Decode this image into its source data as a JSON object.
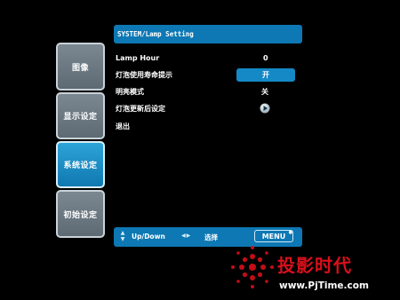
{
  "side_tabs": [
    {
      "label": "图像",
      "active": false
    },
    {
      "label": "显示设定",
      "active": false
    },
    {
      "label": "系统设定",
      "active": true
    },
    {
      "label": "初始设定",
      "active": false
    }
  ],
  "header": {
    "title": "SYSTEM/Lamp Setting"
  },
  "menu": {
    "items": [
      {
        "label": "Lamp Hour",
        "value": "0"
      },
      {
        "label": "灯泡使用寿命提示",
        "value": "开"
      },
      {
        "label": "明亮模式",
        "value": "关"
      },
      {
        "label": "灯泡更新后设定",
        "value": ""
      },
      {
        "label": "退出",
        "value": ""
      }
    ]
  },
  "footer": {
    "updown_label": "Up/Down",
    "select_label": "选择",
    "menu_label": "MENU"
  },
  "watermark": {
    "brand": "投影时代",
    "url": "www.PjTime.com"
  },
  "colors": {
    "accent": "#0d78b4",
    "active_tab": "#1a8fcb",
    "inactive_tab": "#6b7781",
    "watermark_red": "#d8101b"
  },
  "icons": [
    "up-down-arrows-icon",
    "left-right-arrows-icon",
    "right-arrow-icon",
    "pjtime-logo-icon"
  ]
}
